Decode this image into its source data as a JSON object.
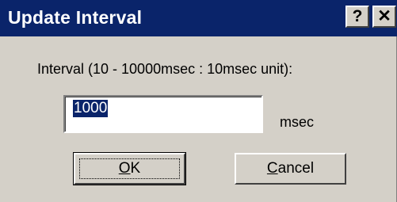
{
  "window": {
    "title": "Update Interval",
    "help_glyph": "?",
    "close_glyph": "✕"
  },
  "form": {
    "label": "Interval (10 - 10000msec : 10msec unit):",
    "value": "1000",
    "unit": "msec"
  },
  "buttons": {
    "ok_first": "O",
    "ok_rest": "K",
    "cancel_first": "C",
    "cancel_rest": "ancel"
  },
  "colors": {
    "titlebar": "#0a246a",
    "face": "#d4d0c8",
    "selection": "#0a246a"
  },
  "icons": [
    "help-icon",
    "close-icon"
  ]
}
